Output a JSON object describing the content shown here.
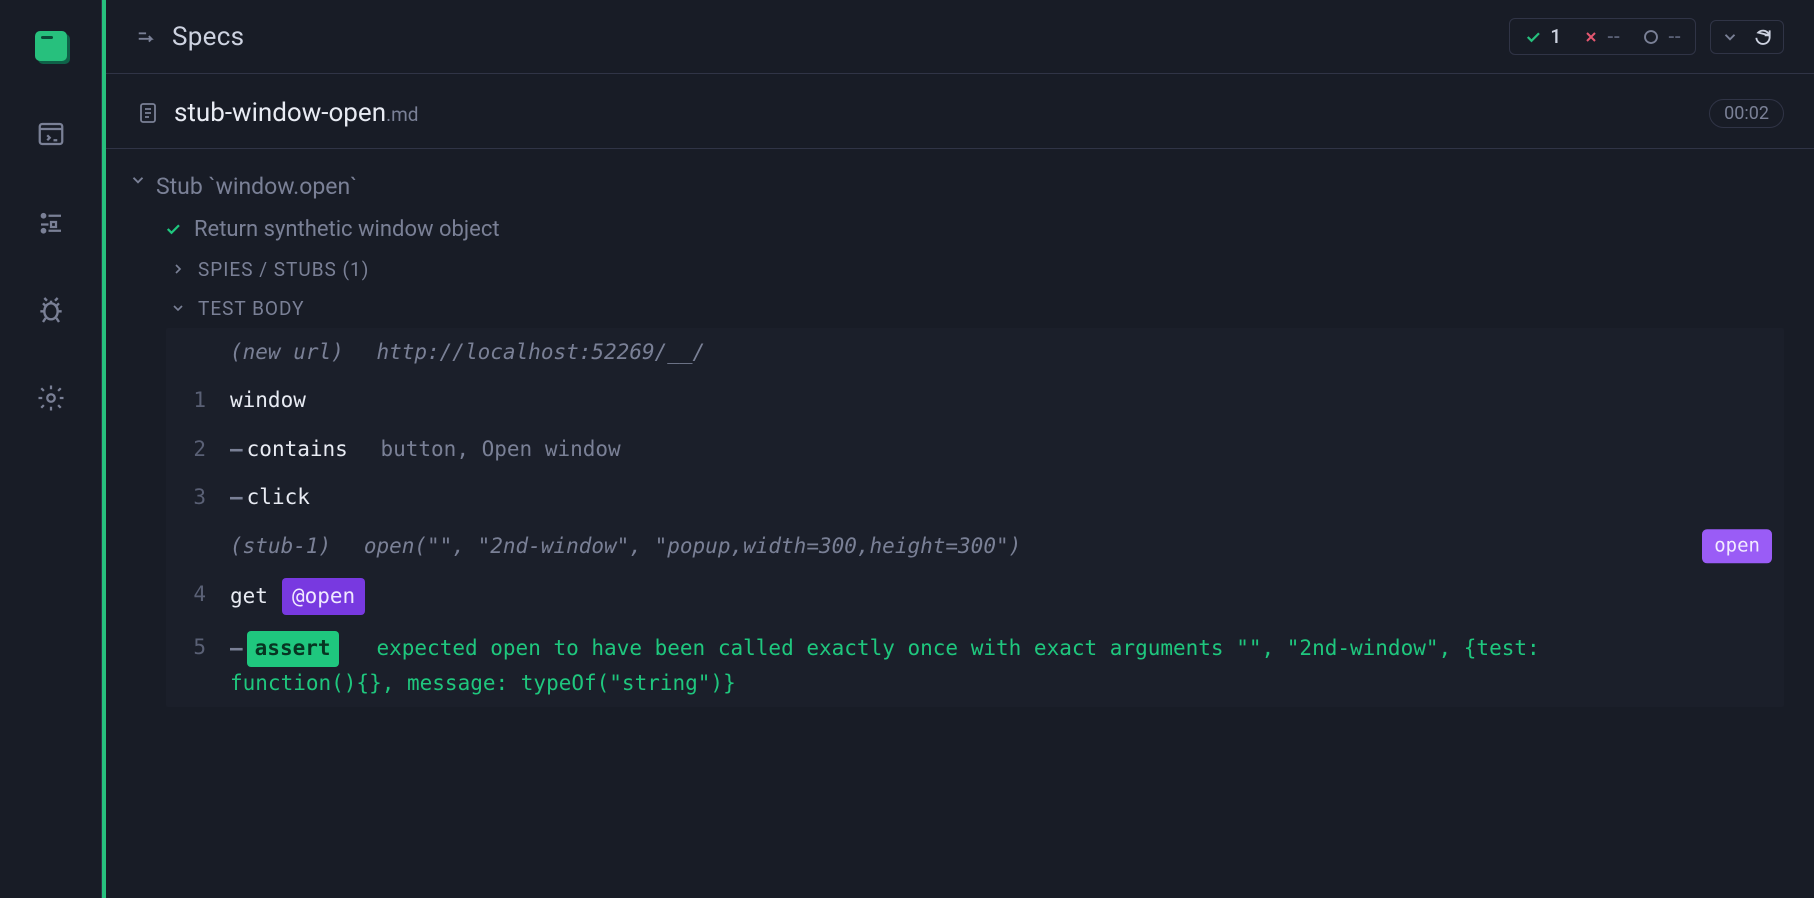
{
  "header": {
    "breadcrumb": "Specs",
    "stats": {
      "passed": "1",
      "failed": "--",
      "pending": "--"
    }
  },
  "file": {
    "name": "stub-window-open",
    "ext": ".md",
    "duration": "00:02"
  },
  "describe": {
    "title": "Stub `window.open`"
  },
  "test": {
    "title": "Return synthetic window object"
  },
  "sections": {
    "spies": "SPIES / STUBS (1)",
    "body": "TEST BODY"
  },
  "log": {
    "newurl_label": "(new url)",
    "newurl_value": "http://localhost:52269/__/",
    "l1": "window",
    "l2_cmd": "contains",
    "l2_args": "button, Open window",
    "l3_cmd": "click",
    "stub_label": "(stub-1)",
    "stub_value": "open(\"\", \"2nd-window\", \"popup,width=300,height=300\")",
    "stub_badge": "open",
    "l4_cmd": "get",
    "l4_alias": "@open",
    "l5_pill": "assert",
    "l5_text1": "expected open to have been called exactly once with exact arguments \"\", \"2nd-window\", {test:",
    "l5_text2": "function(){}, message: typeOf(\"string\")}"
  },
  "gutter": {
    "n1": "1",
    "n2": "2",
    "n3": "3",
    "n4": "4",
    "n5": "5"
  }
}
